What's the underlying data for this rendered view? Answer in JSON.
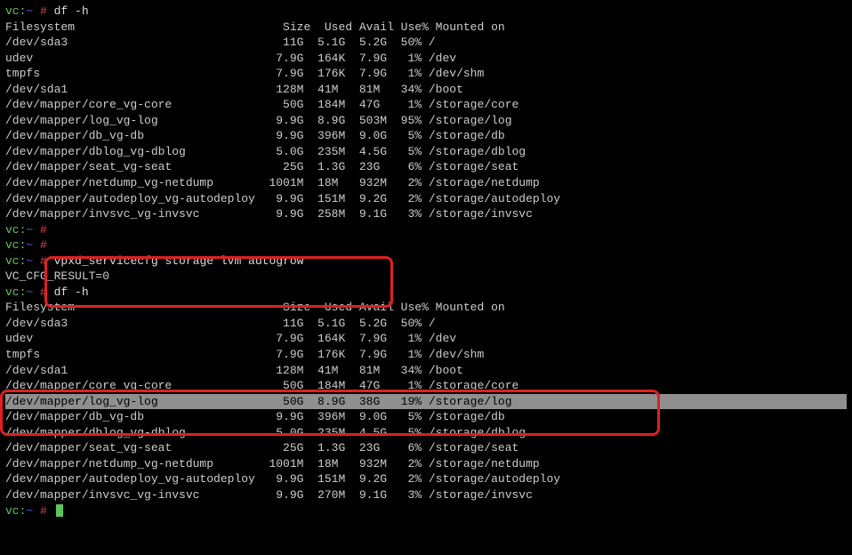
{
  "prompt": {
    "host": "vc:",
    "tilde": "~",
    "hash": " # ",
    "cmd1": "df -h",
    "cmd2": "vpxd_servicecfg storage lvm autogrow",
    "result": "VC_CFG_RESULT=0"
  },
  "headers": {
    "fs": "Filesystem",
    "size": "Size",
    "used": "Used",
    "avail": "Avail",
    "usep": "Use%",
    "mount": "Mounted on"
  },
  "df1": [
    {
      "fs": "/dev/sda3",
      "size": "11G",
      "used": "5.1G",
      "avail": "5.2G",
      "usep": "50%",
      "mount": "/"
    },
    {
      "fs": "udev",
      "size": "7.9G",
      "used": "164K",
      "avail": "7.9G",
      "usep": "1%",
      "mount": "/dev"
    },
    {
      "fs": "tmpfs",
      "size": "7.9G",
      "used": "176K",
      "avail": "7.9G",
      "usep": "1%",
      "mount": "/dev/shm"
    },
    {
      "fs": "/dev/sda1",
      "size": "128M",
      "used": "41M",
      "avail": "81M",
      "usep": "34%",
      "mount": "/boot"
    },
    {
      "fs": "/dev/mapper/core_vg-core",
      "size": "50G",
      "used": "184M",
      "avail": "47G",
      "usep": "1%",
      "mount": "/storage/core"
    },
    {
      "fs": "/dev/mapper/log_vg-log",
      "size": "9.9G",
      "used": "8.9G",
      "avail": "503M",
      "usep": "95%",
      "mount": "/storage/log"
    },
    {
      "fs": "/dev/mapper/db_vg-db",
      "size": "9.9G",
      "used": "396M",
      "avail": "9.0G",
      "usep": "5%",
      "mount": "/storage/db"
    },
    {
      "fs": "/dev/mapper/dblog_vg-dblog",
      "size": "5.0G",
      "used": "235M",
      "avail": "4.5G",
      "usep": "5%",
      "mount": "/storage/dblog"
    },
    {
      "fs": "/dev/mapper/seat_vg-seat",
      "size": "25G",
      "used": "1.3G",
      "avail": "23G",
      "usep": "6%",
      "mount": "/storage/seat"
    },
    {
      "fs": "/dev/mapper/netdump_vg-netdump",
      "size": "1001M",
      "used": "18M",
      "avail": "932M",
      "usep": "2%",
      "mount": "/storage/netdump"
    },
    {
      "fs": "/dev/mapper/autodeploy_vg-autodeploy",
      "size": "9.9G",
      "used": "151M",
      "avail": "9.2G",
      "usep": "2%",
      "mount": "/storage/autodeploy"
    },
    {
      "fs": "/dev/mapper/invsvc_vg-invsvc",
      "size": "9.9G",
      "used": "258M",
      "avail": "9.1G",
      "usep": "3%",
      "mount": "/storage/invsvc"
    }
  ],
  "df2": [
    {
      "fs": "/dev/sda3",
      "size": "11G",
      "used": "5.1G",
      "avail": "5.2G",
      "usep": "50%",
      "mount": "/"
    },
    {
      "fs": "udev",
      "size": "7.9G",
      "used": "164K",
      "avail": "7.9G",
      "usep": "1%",
      "mount": "/dev"
    },
    {
      "fs": "tmpfs",
      "size": "7.9G",
      "used": "176K",
      "avail": "7.9G",
      "usep": "1%",
      "mount": "/dev/shm"
    },
    {
      "fs": "/dev/sda1",
      "size": "128M",
      "used": "41M",
      "avail": "81M",
      "usep": "34%",
      "mount": "/boot"
    },
    {
      "fs": "/dev/mapper/core_vg-core",
      "size": "50G",
      "used": "184M",
      "avail": "47G",
      "usep": "1%",
      "mount": "/storage/core"
    },
    {
      "fs": "/dev/mapper/log_vg-log",
      "size": "50G",
      "used": "8.9G",
      "avail": "38G",
      "usep": "19%",
      "mount": "/storage/log",
      "hl": true
    },
    {
      "fs": "/dev/mapper/db_vg-db",
      "size": "9.9G",
      "used": "396M",
      "avail": "9.0G",
      "usep": "5%",
      "mount": "/storage/db"
    },
    {
      "fs": "/dev/mapper/dblog_vg-dblog",
      "size": "5.0G",
      "used": "235M",
      "avail": "4.5G",
      "usep": "5%",
      "mount": "/storage/dblog"
    },
    {
      "fs": "/dev/mapper/seat_vg-seat",
      "size": "25G",
      "used": "1.3G",
      "avail": "23G",
      "usep": "6%",
      "mount": "/storage/seat"
    },
    {
      "fs": "/dev/mapper/netdump_vg-netdump",
      "size": "1001M",
      "used": "18M",
      "avail": "932M",
      "usep": "2%",
      "mount": "/storage/netdump"
    },
    {
      "fs": "/dev/mapper/autodeploy_vg-autodeploy",
      "size": "9.9G",
      "used": "151M",
      "avail": "9.2G",
      "usep": "2%",
      "mount": "/storage/autodeploy"
    },
    {
      "fs": "/dev/mapper/invsvc_vg-invsvc",
      "size": "9.9G",
      "used": "270M",
      "avail": "9.1G",
      "usep": "3%",
      "mount": "/storage/invsvc"
    }
  ]
}
